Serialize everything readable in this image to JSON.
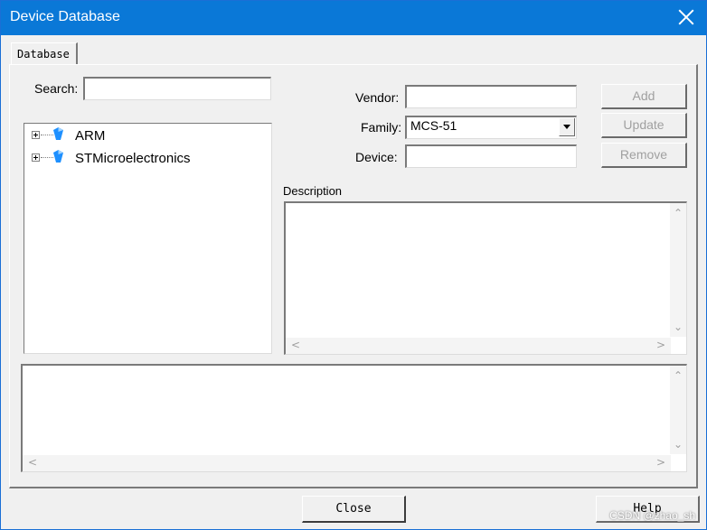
{
  "window": {
    "title": "Device Database"
  },
  "tabs": [
    {
      "label": "Database"
    }
  ],
  "search": {
    "label": "Search:",
    "value": ""
  },
  "tree": {
    "items": [
      {
        "label": "ARM",
        "icon": "gem-icon"
      },
      {
        "label": "STMicroelectronics",
        "icon": "gem-icon"
      }
    ]
  },
  "form": {
    "vendor": {
      "label": "Vendor:",
      "value": ""
    },
    "family": {
      "label": "Family:",
      "value": "MCS-51"
    },
    "device": {
      "label": "Device:",
      "value": ""
    },
    "description_label": "Description"
  },
  "buttons": {
    "add": "Add",
    "update": "Update",
    "remove": "Remove",
    "close": "Close",
    "help": "Help"
  },
  "watermark": "CSDN @zhao_sh",
  "colors": {
    "titlebar": "#0a78d7",
    "accent_gem": "#1e90ff"
  }
}
